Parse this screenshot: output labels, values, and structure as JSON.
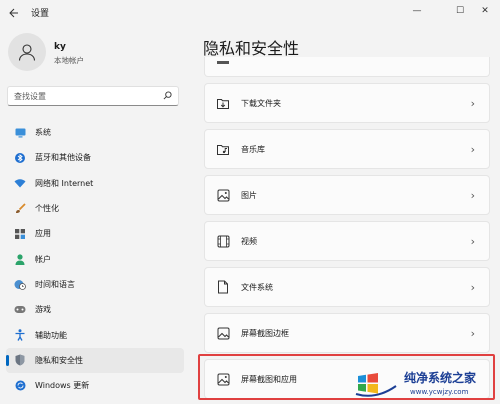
{
  "window": {
    "title": "设置",
    "controls": {
      "minimize": "—",
      "maximize": "☐",
      "close": "✕"
    }
  },
  "profile": {
    "name": "ky",
    "subtitle": "本地帐户"
  },
  "search": {
    "placeholder": "查找设置"
  },
  "sidebar": {
    "items": [
      {
        "label": "系统",
        "icon": "monitor-icon",
        "active": false
      },
      {
        "label": "蓝牙和其他设备",
        "icon": "bluetooth-icon",
        "active": false
      },
      {
        "label": "网络和 Internet",
        "icon": "wifi-icon",
        "active": false
      },
      {
        "label": "个性化",
        "icon": "brush-icon",
        "active": false
      },
      {
        "label": "应用",
        "icon": "apps-icon",
        "active": false
      },
      {
        "label": "帐户",
        "icon": "person-icon",
        "active": false
      },
      {
        "label": "时间和语言",
        "icon": "globe-clock-icon",
        "active": false
      },
      {
        "label": "游戏",
        "icon": "gamepad-icon",
        "active": false
      },
      {
        "label": "辅助功能",
        "icon": "accessibility-icon",
        "active": false
      },
      {
        "label": "隐私和安全性",
        "icon": "shield-icon",
        "active": true
      },
      {
        "label": "Windows 更新",
        "icon": "update-icon",
        "active": false
      }
    ]
  },
  "main": {
    "title": "隐私和安全性",
    "items": [
      {
        "label": "下载文件夹",
        "icon": "download-icon"
      },
      {
        "label": "音乐库",
        "icon": "music-folder-icon"
      },
      {
        "label": "图片",
        "icon": "image-icon"
      },
      {
        "label": "视频",
        "icon": "video-icon"
      },
      {
        "label": "文件系统",
        "icon": "file-icon"
      },
      {
        "label": "屏幕截图边框",
        "icon": "screenshot-border-icon"
      },
      {
        "label": "屏幕截图和应用",
        "icon": "screenshot-icon"
      }
    ]
  },
  "watermark": {
    "title": "纯净系统之家",
    "url": "www.ycwjzy.com"
  },
  "colors": {
    "accent": "#0067c0",
    "highlight": "#e04040",
    "watermark": "#1c3f95"
  }
}
